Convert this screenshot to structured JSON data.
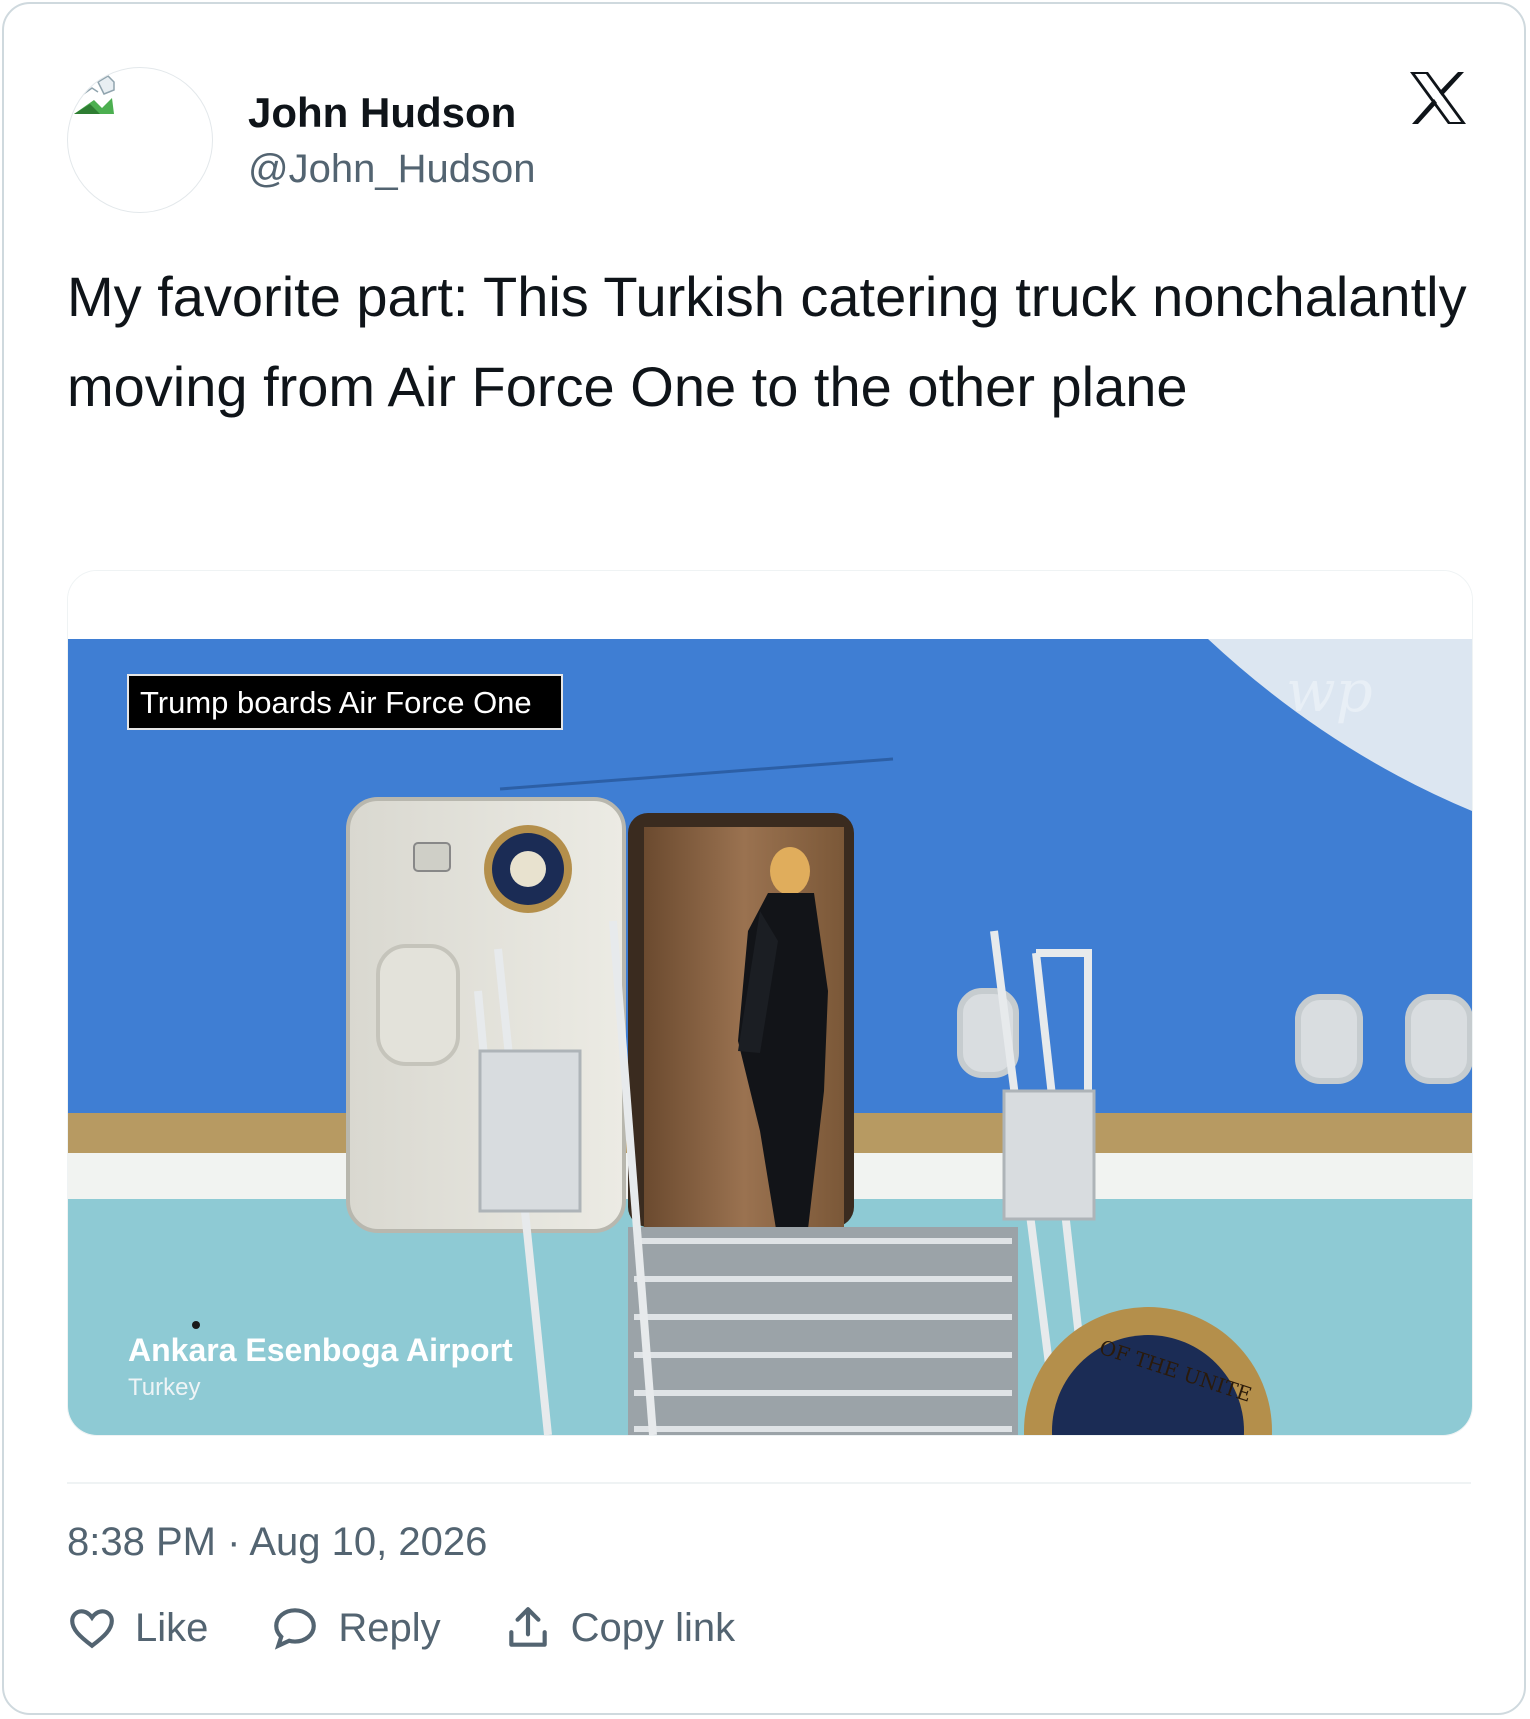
{
  "author": {
    "name": "John Hudson",
    "handle": "@John_Hudson"
  },
  "tweet": {
    "text": "My favorite part: This Turkish catering truck nonchalantly moving from Air Force One to the other plane"
  },
  "media": {
    "caption_top": "Trump boards Air Force One",
    "location_title": "Ankara Esenboga Airport",
    "location_subtitle": "Turkey",
    "seal_text": "OF THE UNITE",
    "watermark": "wp"
  },
  "meta": {
    "time": "8:38 PM",
    "separator": "·",
    "date": "Aug 10, 2026"
  },
  "actions": {
    "like": "Like",
    "reply": "Reply",
    "copy_link": "Copy link"
  },
  "icons": {
    "logo": "x-logo-icon",
    "like": "heart-icon",
    "reply": "speech-bubble-icon",
    "copy": "share-upload-icon",
    "avatar": "broken-image-icon"
  },
  "colors": {
    "text": "#0f1419",
    "secondary": "#536471",
    "border": "#cfd9de",
    "fuselage_blue": "#3f7ed3",
    "fuselage_cyan": "#8ecad4"
  }
}
